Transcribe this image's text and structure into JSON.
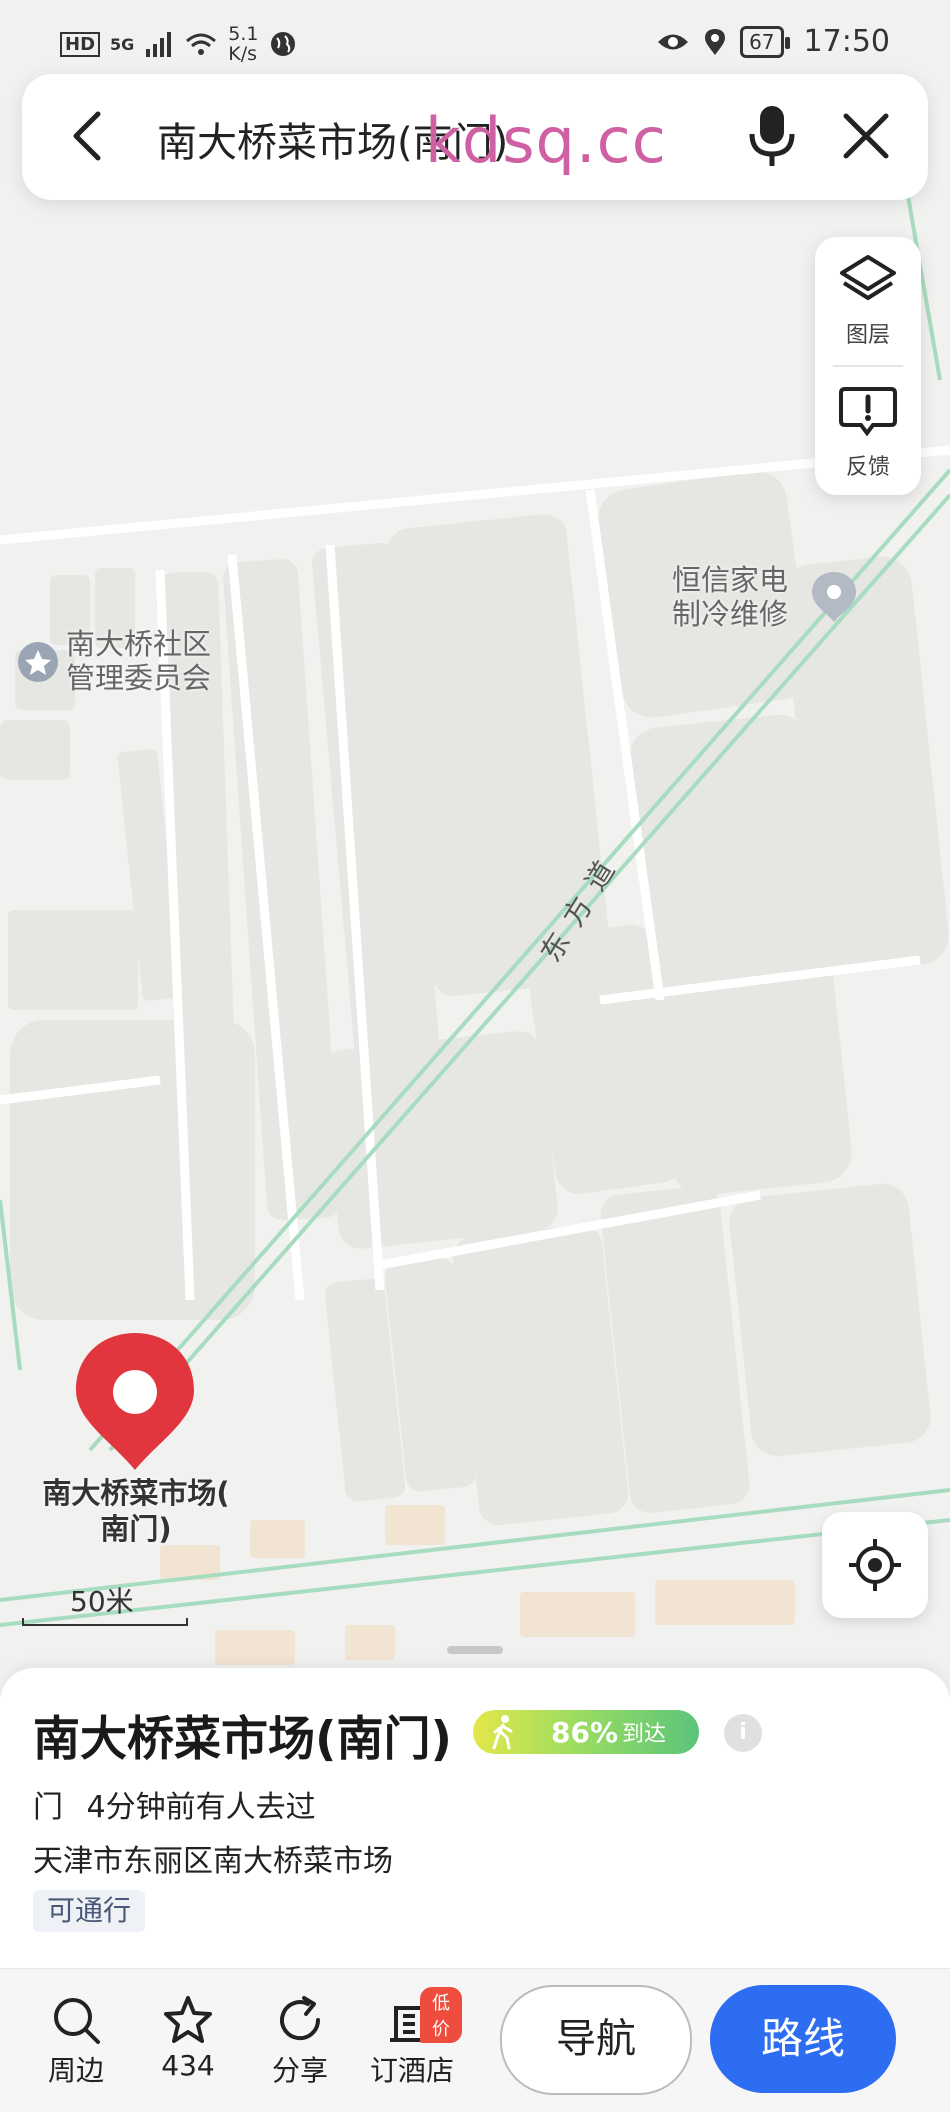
{
  "status_bar": {
    "network": "HD",
    "signal": "5G",
    "speed_value": "5.1",
    "speed_unit": "K/s",
    "battery": "67",
    "time": "17:50"
  },
  "search": {
    "query": "南大桥菜市场(南门)",
    "watermark": "kdsq.cc"
  },
  "tools": {
    "layers_label": "图层",
    "feedback_label": "反馈"
  },
  "map": {
    "poi_appliance_line1": "恒信家电",
    "poi_appliance_line2": "制冷维修",
    "poi_committee_line1": "南大桥社区",
    "poi_committee_line2": "管理委员会",
    "road_name": "东方道",
    "pin_label_line1": "南大桥菜市场(",
    "pin_label_line2": "南门)",
    "scale": "50米",
    "colors": {
      "road": "#a8dcc0",
      "block": "#e6e6e3",
      "pin": "#e2363f"
    }
  },
  "place": {
    "title": "南大桥菜市场(南门)",
    "arrival_percent": "86%",
    "arrival_label": "到达",
    "info_icon": "i",
    "type": "门",
    "recent_visit": "4分钟前有人去过",
    "address": "天津市东丽区南大桥菜市场",
    "tag": "可通行"
  },
  "bottom_nav": {
    "nearby": "周边",
    "favorites_count": "434",
    "share": "分享",
    "hotel": "订酒店",
    "hotel_badge": "低价",
    "navigate": "导航",
    "route": "路线"
  }
}
